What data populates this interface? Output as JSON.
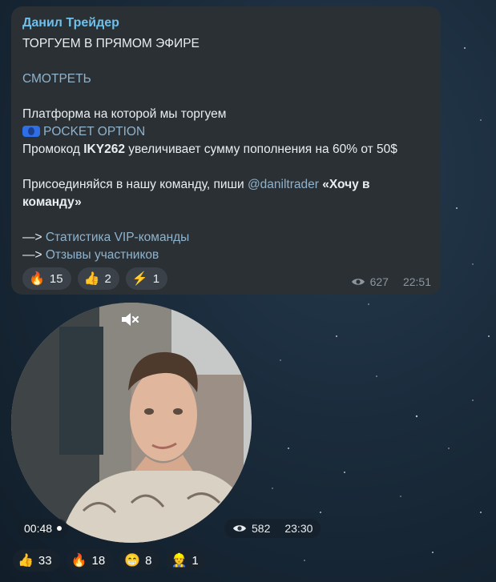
{
  "message": {
    "sender": "Данил Трейдер",
    "line1": "ТОРГУЕМ В ПРЯМОМ ЭФИРЕ",
    "watch_link": "СМОТРЕТЬ",
    "platform_line": "Платформа на которой мы торгуем",
    "platform_name": "POCKET OPTION",
    "promo_prefix": "Промокод ",
    "promo_code": "IKY262",
    "promo_suffix": " увеличивает сумму пополнения на 60% от 50$",
    "join_prefix": "Присоединяйся в нашу команду, пиши ",
    "join_handle": "@daniltrader",
    "join_quote_1": "«Хочу в",
    "join_quote_2": "команду»",
    "arrow": "—> ",
    "stats_link": "Статистика VIP-команды",
    "reviews_link": "Отзывы участников",
    "views": "627",
    "time": "22:51",
    "reactions": [
      {
        "emoji": "🔥",
        "count": "15"
      },
      {
        "emoji": "👍",
        "count": "2"
      },
      {
        "emoji": "⚡",
        "count": "1"
      }
    ]
  },
  "video_message": {
    "duration": "00:48",
    "views": "582",
    "time": "23:30",
    "reactions": [
      {
        "emoji": "👍",
        "count": "33"
      },
      {
        "emoji": "🔥",
        "count": "18"
      },
      {
        "emoji": "😁",
        "count": "8"
      },
      {
        "emoji": "👷",
        "count": "1"
      }
    ]
  },
  "colors": {
    "sender": "#6ec0ea",
    "link": "#8fb3cc",
    "bubble": "#2b3035"
  }
}
